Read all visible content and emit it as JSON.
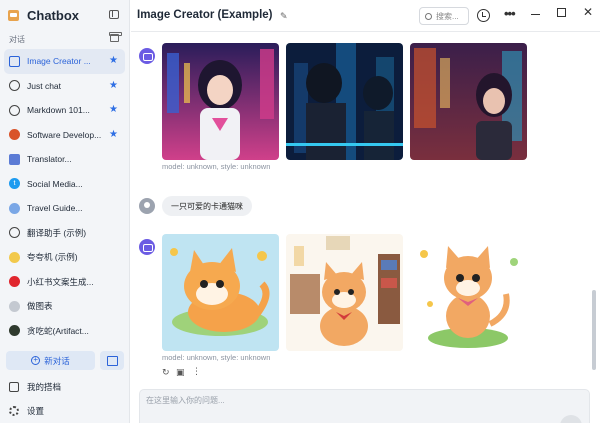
{
  "app": {
    "name": "Chatbox"
  },
  "sidebar": {
    "section_label": "对话",
    "sessions": [
      {
        "label": "Image Creator ...",
        "icon": "image-icon",
        "starred": true,
        "active": true
      },
      {
        "label": "Just chat",
        "icon": "chat-bubble-icon",
        "starred": true
      },
      {
        "label": "Markdown 101...",
        "icon": "chat-bubble-icon",
        "starred": true
      },
      {
        "label": "Software Develop...",
        "icon": "avatar-icon",
        "starred": true
      },
      {
        "label": "Translator...",
        "icon": "translate-icon"
      },
      {
        "label": "Social Media...",
        "icon": "twitter-icon"
      },
      {
        "label": "Travel Guide...",
        "icon": "globe-icon"
      },
      {
        "label": "翻译助手 (示例)",
        "icon": "chat-bubble-icon"
      },
      {
        "label": "夸夸机 (示例)",
        "icon": "sparkle-icon"
      },
      {
        "label": "小红书文案生成...",
        "icon": "xiaohongshu-icon"
      },
      {
        "label": "做图表",
        "icon": "chart-icon"
      },
      {
        "label": "贪吃蛇(Artifact...",
        "icon": "snake-icon"
      }
    ],
    "new_chat_label": "新对话",
    "my_partners_label": "我的搭档",
    "settings_label": "设置"
  },
  "header": {
    "title": "Image Creator (Example)",
    "search_label": "搜索..."
  },
  "messages": [
    {
      "role": "assistant",
      "meta": "model: unknown, style: unknown"
    },
    {
      "role": "user",
      "text": "一只可爱的卡通猫咪"
    },
    {
      "role": "assistant",
      "meta": "model: unknown, style: unknown"
    }
  ],
  "input": {
    "placeholder": "在这里输入你的问题..."
  },
  "colors": {
    "accent": "#2f6fe4",
    "bot_avatar": "#6b5be3",
    "sidebar_bg": "#f3f5f8"
  }
}
